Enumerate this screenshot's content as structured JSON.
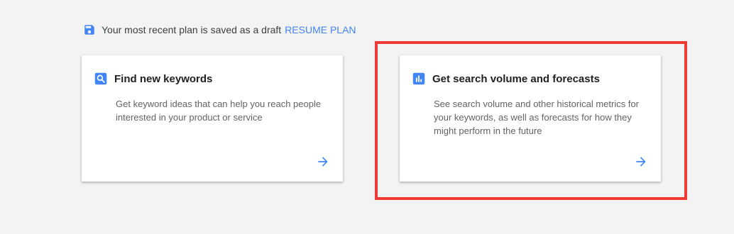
{
  "draft_bar": {
    "message": "Your most recent plan is saved as a draft",
    "resume_link": "RESUME PLAN",
    "icon": "save-icon"
  },
  "cards": [
    {
      "title": "Find new keywords",
      "description": "Get keyword ideas that can help you reach people interested in your product or service",
      "icon": "search-icon"
    },
    {
      "title": "Get search volume and forecasts",
      "description": "See search volume and other historical metrics for your keywords, as well as forecasts for how they might perform in the future",
      "icon": "bar-chart-icon"
    }
  ],
  "colors": {
    "accent": "#4285f4",
    "highlight": "#ef3b35",
    "background": "#f3f3f3"
  }
}
